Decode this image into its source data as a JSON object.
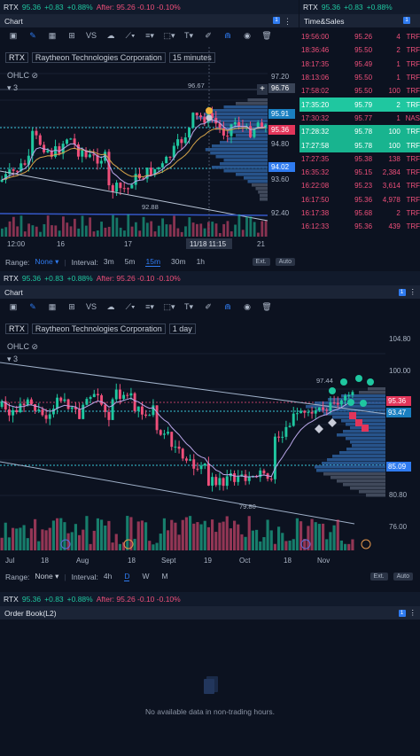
{
  "quote": {
    "symbol": "RTX",
    "price": "95.36",
    "change": "+0.83",
    "pct": "+0.88%",
    "after": "After: 95.26 -0.10 -0.10%"
  },
  "quote_short": {
    "symbol": "RTX",
    "price": "95.36",
    "change": "+0.83",
    "pct": "+0.88%"
  },
  "panels": {
    "chart_title": "Chart",
    "ts_title": "Time&Sales",
    "order_title": "Order Book(L2)",
    "badge": "1"
  },
  "chart1": {
    "ticker": "RTX",
    "company": "Raytheon Technologies Corporation",
    "interval": "15 minutes",
    "study": "OHLC",
    "count": "3",
    "yaxis": [
      "97.20",
      "94.80",
      "93.60",
      "92.40"
    ],
    "high_label": "96.67",
    "low_label": "92.88",
    "price_tags": {
      "top": "96.76",
      "cyan": "95.91",
      "red": "95.36",
      "blue": "94.02"
    },
    "xaxis": [
      "12:00",
      "16",
      "17",
      "21"
    ],
    "cursor_time": "11/18 11:15"
  },
  "chart2": {
    "ticker": "RTX",
    "company": "Raytheon Technologies Corporation",
    "interval": "1 day",
    "study": "OHLC",
    "count": "3",
    "yaxis": [
      "104.80",
      "100.00",
      "80.80",
      "76.00"
    ],
    "high_label": "97.44",
    "low_label": "79.80",
    "price_tags": {
      "red": "95.36",
      "cyan": "93.47",
      "blue": "85.09"
    },
    "xaxis": [
      "Jul",
      "18",
      "Aug",
      "18",
      "Sept",
      "19",
      "Oct",
      "18",
      "Nov"
    ]
  },
  "footer1": {
    "range": "Range:",
    "range_val": "None",
    "interval": "Interval:",
    "options": [
      "3m",
      "5m",
      "15m",
      "30m",
      "1h"
    ],
    "active": "15m",
    "ext": "Ext.",
    "auto": "Auto"
  },
  "footer2": {
    "range": "Range:",
    "range_val": "None",
    "interval": "Interval:",
    "options": [
      "4h",
      "D",
      "W",
      "M"
    ],
    "active": "D",
    "ext": "Ext.",
    "auto": "Auto"
  },
  "orderbook": {
    "empty": "No available data in non-trading hours."
  },
  "time_sales": [
    {
      "time": "19:56:00",
      "price": "95.26",
      "size": "4",
      "ex": "TRF",
      "hl": ""
    },
    {
      "time": "18:36:46",
      "price": "95.50",
      "size": "2",
      "ex": "TRF",
      "hl": ""
    },
    {
      "time": "18:17:35",
      "price": "95.49",
      "size": "1",
      "ex": "TRF",
      "hl": ""
    },
    {
      "time": "18:13:06",
      "price": "95.50",
      "size": "1",
      "ex": "TRF",
      "hl": ""
    },
    {
      "time": "17:58:02",
      "price": "95.50",
      "size": "100",
      "ex": "TRF",
      "hl": ""
    },
    {
      "time": "17:35:20",
      "price": "95.79",
      "size": "2",
      "ex": "TRF",
      "hl": "bright"
    },
    {
      "time": "17:30:32",
      "price": "95.77",
      "size": "1",
      "ex": "NAS",
      "hl": ""
    },
    {
      "time": "17:28:32",
      "price": "95.78",
      "size": "100",
      "ex": "TRF",
      "hl": "green"
    },
    {
      "time": "17:27:58",
      "price": "95.78",
      "size": "100",
      "ex": "TRF",
      "hl": "green"
    },
    {
      "time": "17:27:35",
      "price": "95.38",
      "size": "138",
      "ex": "TRF",
      "hl": ""
    },
    {
      "time": "16:35:32",
      "price": "95.15",
      "size": "2,384",
      "ex": "TRF",
      "hl": ""
    },
    {
      "time": "16:22:08",
      "price": "95.23",
      "size": "3,614",
      "ex": "TRF",
      "hl": ""
    },
    {
      "time": "16:17:50",
      "price": "95.36",
      "size": "4,978",
      "ex": "TRF",
      "hl": ""
    },
    {
      "time": "16:17:38",
      "price": "95.68",
      "size": "2",
      "ex": "TRF",
      "hl": ""
    },
    {
      "time": "16:12:33",
      "price": "95.36",
      "size": "439",
      "ex": "TRF",
      "hl": ""
    }
  ],
  "colors": {
    "up": "#1fc7a0",
    "down": "#ef4f7a",
    "accent": "#2f7bf0"
  }
}
